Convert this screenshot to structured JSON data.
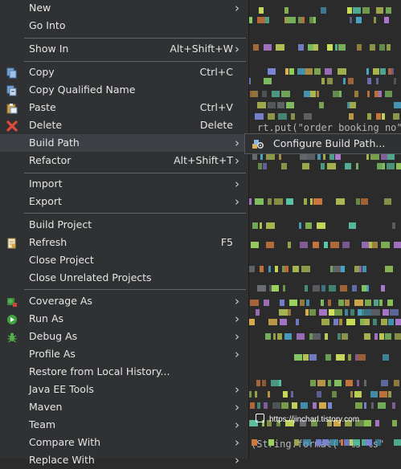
{
  "context_menu": {
    "items": [
      {
        "label": "New",
        "shortcut": "",
        "submenu": true,
        "icon": ""
      },
      {
        "label": "Go Into",
        "shortcut": "",
        "submenu": false,
        "icon": ""
      },
      {
        "label": "Show In",
        "shortcut": "Alt+Shift+W",
        "submenu": true,
        "icon": ""
      },
      {
        "label": "Copy",
        "shortcut": "Ctrl+C",
        "submenu": false,
        "icon": "copy-icon"
      },
      {
        "label": "Copy Qualified Name",
        "shortcut": "",
        "submenu": false,
        "icon": "copy-qualified-name-icon"
      },
      {
        "label": "Paste",
        "shortcut": "Ctrl+V",
        "submenu": false,
        "icon": "paste-icon"
      },
      {
        "label": "Delete",
        "shortcut": "Delete",
        "submenu": false,
        "icon": "delete-icon"
      },
      {
        "label": "Build Path",
        "shortcut": "",
        "submenu": true,
        "icon": ""
      },
      {
        "label": "Refactor",
        "shortcut": "Alt+Shift+T",
        "submenu": true,
        "icon": ""
      },
      {
        "label": "Import",
        "shortcut": "",
        "submenu": true,
        "icon": ""
      },
      {
        "label": "Export",
        "shortcut": "",
        "submenu": true,
        "icon": ""
      },
      {
        "label": "Build Project",
        "shortcut": "",
        "submenu": false,
        "icon": ""
      },
      {
        "label": "Refresh",
        "shortcut": "F5",
        "submenu": false,
        "icon": "refresh-icon"
      },
      {
        "label": "Close Project",
        "shortcut": "",
        "submenu": false,
        "icon": ""
      },
      {
        "label": "Close Unrelated Projects",
        "shortcut": "",
        "submenu": false,
        "icon": ""
      },
      {
        "label": "Coverage As",
        "shortcut": "",
        "submenu": true,
        "icon": "coverage-icon"
      },
      {
        "label": "Run As",
        "shortcut": "",
        "submenu": true,
        "icon": "run-icon"
      },
      {
        "label": "Debug As",
        "shortcut": "",
        "submenu": true,
        "icon": "debug-bug-icon"
      },
      {
        "label": "Profile As",
        "shortcut": "",
        "submenu": true,
        "icon": ""
      },
      {
        "label": "Restore from Local History...",
        "shortcut": "",
        "submenu": false,
        "icon": ""
      },
      {
        "label": "Java EE Tools",
        "shortcut": "",
        "submenu": true,
        "icon": ""
      },
      {
        "label": "Maven",
        "shortcut": "",
        "submenu": true,
        "icon": ""
      },
      {
        "label": "Team",
        "shortcut": "",
        "submenu": true,
        "icon": ""
      },
      {
        "label": "Compare With",
        "shortcut": "",
        "submenu": true,
        "icon": ""
      },
      {
        "label": "Replace With",
        "shortcut": "",
        "submenu": true,
        "icon": ""
      }
    ],
    "highlighted": "Build Path"
  },
  "submenu": {
    "label": "Configure Build Path...",
    "icon": "configure-build-path-icon"
  },
  "editor": {
    "snippets": [
      "rt.put(\"order booking no\"",
      "(String.format(\" %s %s\""
    ]
  },
  "watermark": "https://jincharl.tistory.com",
  "colors": {
    "menu_background": "#2f3133",
    "highlight": "#3c4045",
    "separator": "#62666a",
    "editor_background": "#2b2b2b",
    "text": "#e6e6e6"
  }
}
